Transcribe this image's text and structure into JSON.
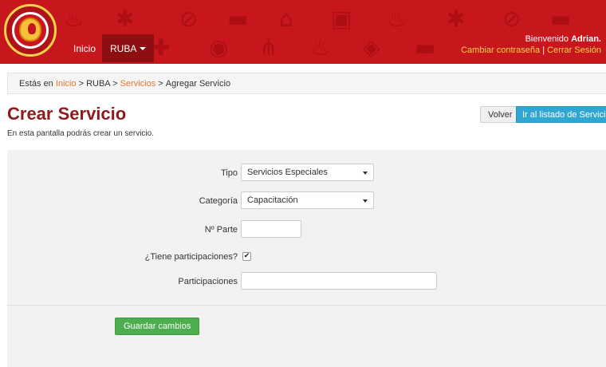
{
  "header": {
    "nav": [
      {
        "label": "Inicio"
      },
      {
        "label": "RUBA"
      }
    ],
    "welcome_prefix": "Bienvenido ",
    "user_name": "Adrian.",
    "change_password": "Cambiar contraseña",
    "separator": " | ",
    "logout": "Cerrar Sesión"
  },
  "breadcrumb": {
    "prefix": "Estás en ",
    "home": "Inicio",
    "sep1": " > RUBA > ",
    "services": "Servicios",
    "sep2": " > ",
    "current": "Agregar Servicio"
  },
  "page": {
    "title": "Crear Servicio",
    "subtitle": "En esta pantalla podrás crear un servicio.",
    "back_label": "Volver",
    "list_label": "Ir al listado de Servicios"
  },
  "form": {
    "tipo": {
      "label": "Tipo",
      "value": "Servicios Especiales"
    },
    "categoria": {
      "label": "Categoría",
      "value": "Capacitación"
    },
    "parte": {
      "label": "Nº Parte",
      "value": ""
    },
    "tiene_participaciones": {
      "label": "¿Tiene participaciones?",
      "checked": true,
      "mark": "✔"
    },
    "participaciones": {
      "label": "Participaciones",
      "value": ""
    },
    "save_label": "Guardar cambios"
  },
  "colors": {
    "header": "#c8161d",
    "nav_active": "#8e0f12",
    "title": "#8e1b1b",
    "link": "#e8772e",
    "primary": "#31a6d3",
    "success": "#4cae4c"
  },
  "icons": [
    "fire-logo",
    "background-firefighter-pattern",
    "chevron-down-icon",
    "checkbox-check-icon"
  ]
}
